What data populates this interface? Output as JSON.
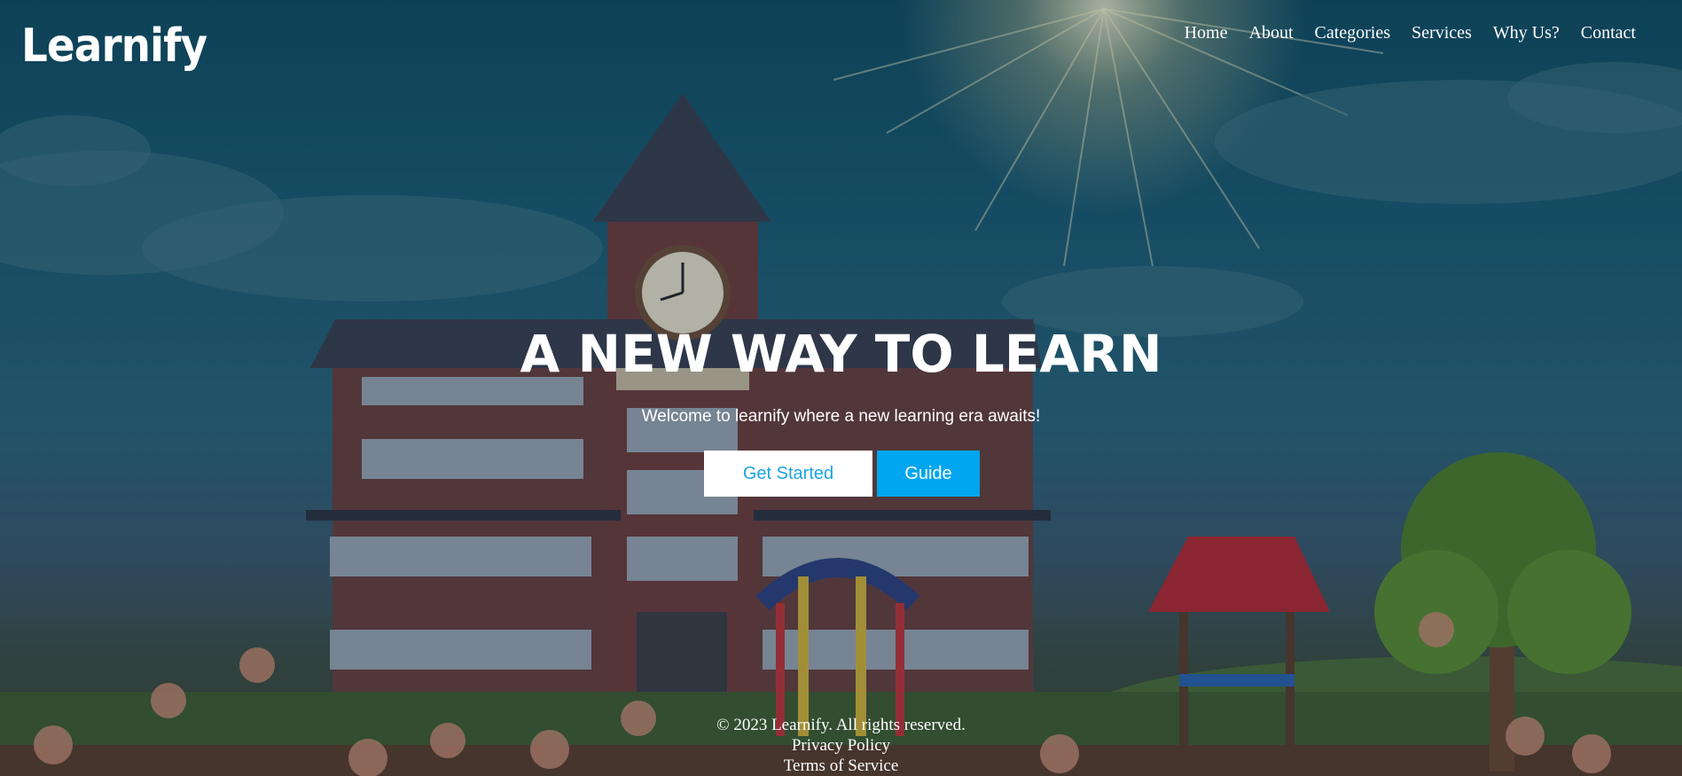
{
  "brand": {
    "logo_text": "Learnify"
  },
  "nav": {
    "items": [
      {
        "label": "Home"
      },
      {
        "label": "About"
      },
      {
        "label": "Categories"
      },
      {
        "label": "Services"
      },
      {
        "label": "Why Us?"
      },
      {
        "label": "Contact"
      }
    ]
  },
  "hero": {
    "title": "A NEW WAY TO LEARN",
    "subtitle": "Welcome to learnify where a new learning era awaits!",
    "primary_button": "Get Started",
    "secondary_button": "Guide",
    "background_illustration": "school-playground-illustration"
  },
  "footer": {
    "copyright": "© 2023 Learnify. All rights reserved.",
    "privacy": "Privacy Policy",
    "terms": "Terms of Service"
  },
  "colors": {
    "accent": "#00a6ef",
    "primary_button_text": "#1ea4e0",
    "text": "#ffffff"
  }
}
